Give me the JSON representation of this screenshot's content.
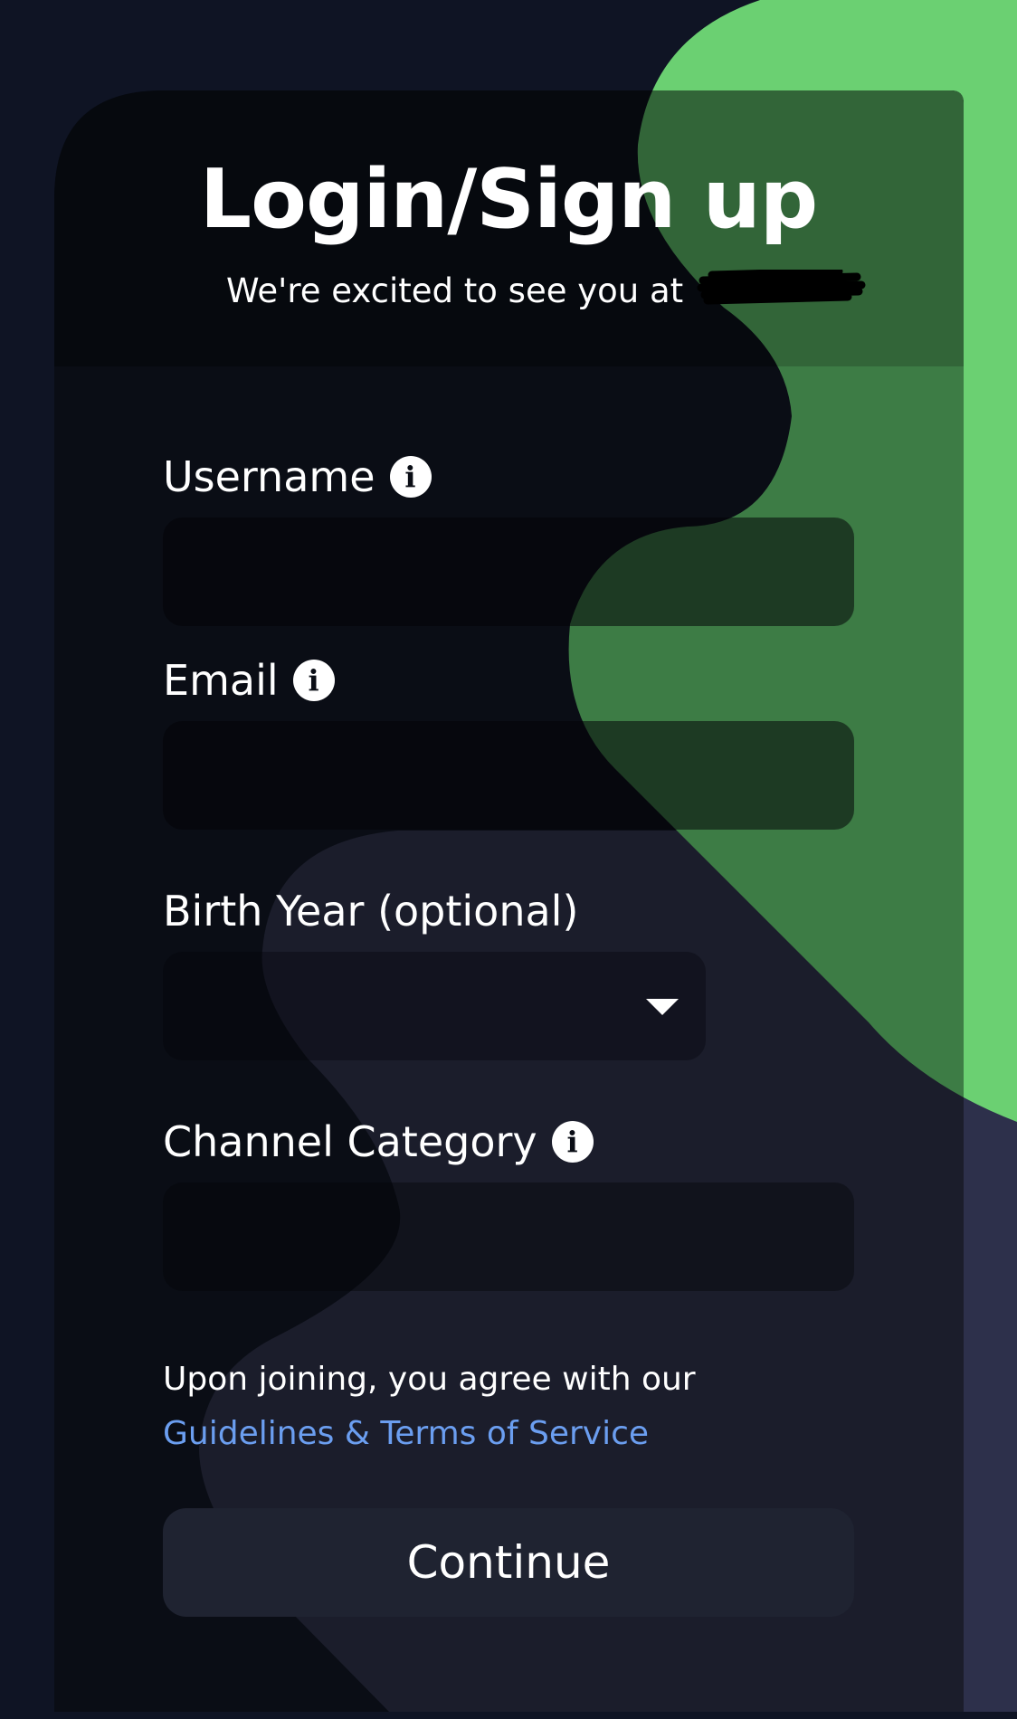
{
  "header": {
    "title": "Login/Sign up",
    "subtitle": "We're excited to see you at",
    "subtitle_redacted": true
  },
  "form": {
    "username": {
      "label": "Username",
      "value": "",
      "info_icon": "info-icon"
    },
    "email": {
      "label": "Email",
      "value": "",
      "info_icon": "info-icon"
    },
    "birth_year": {
      "label": "Birth Year (optional)",
      "selected": "",
      "icon": "caret-down-icon"
    },
    "channel_category": {
      "label": "Channel Category",
      "value": "",
      "info_icon": "info-icon"
    }
  },
  "terms": {
    "prefix": "Upon joining, you agree with our ",
    "link_label": "Guidelines & Terms of Service"
  },
  "continue_label": "Continue",
  "colors": {
    "background": "#0f1424",
    "card": "#0a0d15",
    "green_accent": "#6bd072",
    "link": "#6b9ef0",
    "button": "#1f2331"
  }
}
